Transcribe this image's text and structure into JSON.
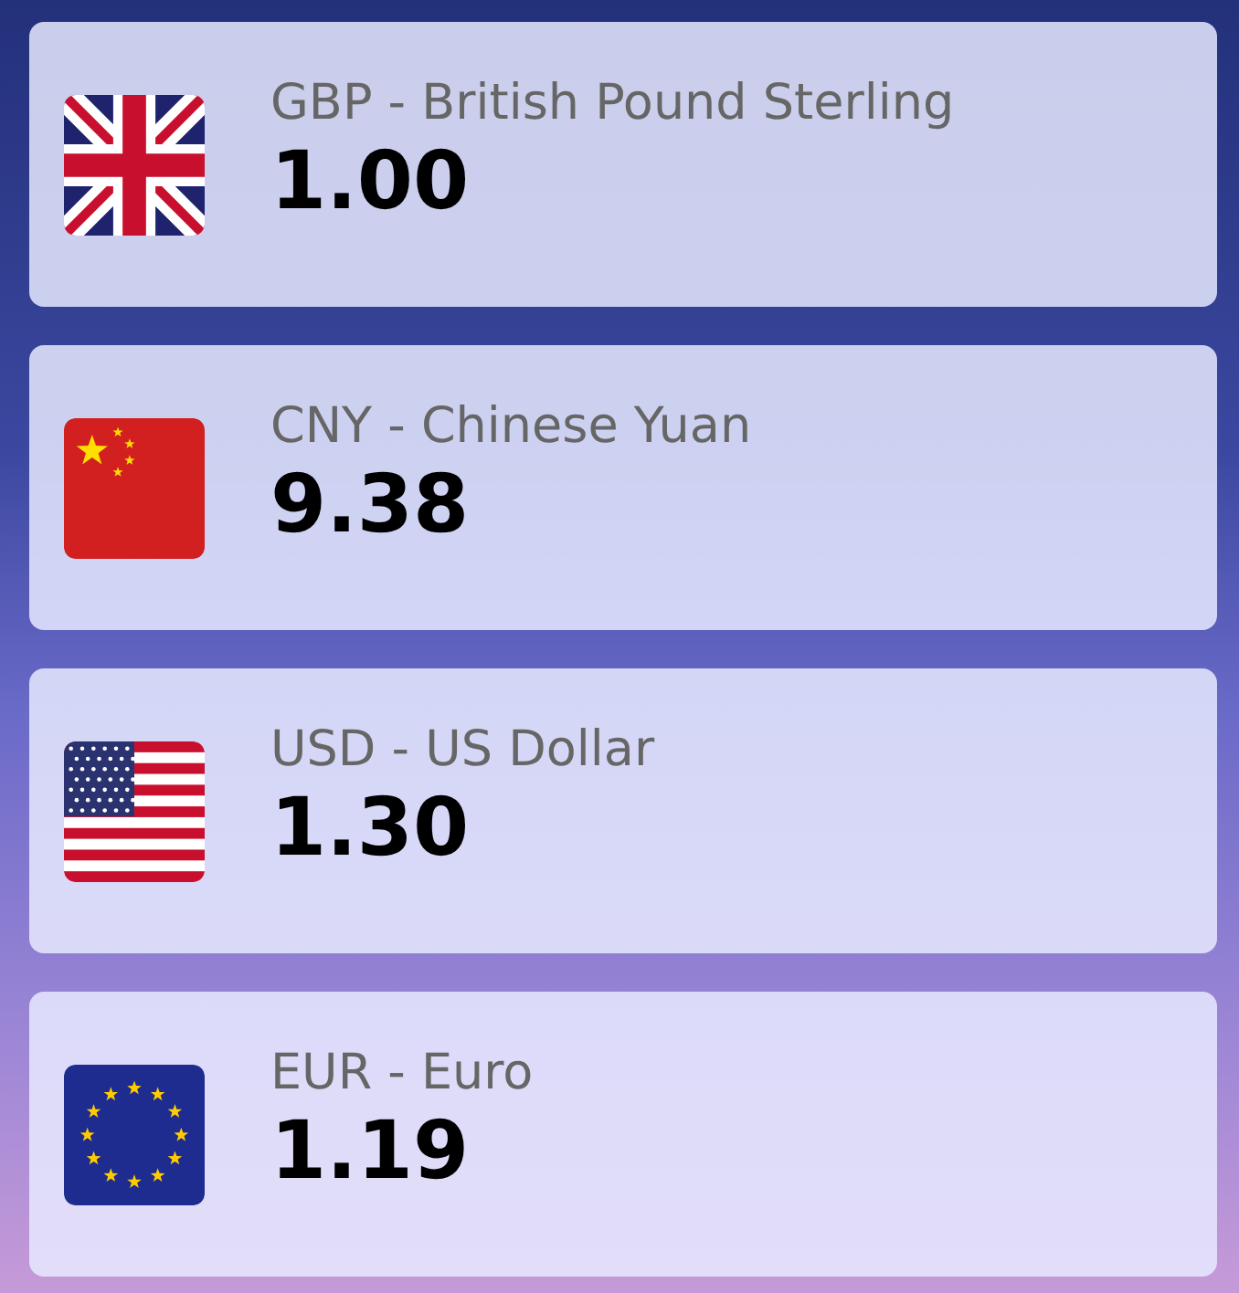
{
  "currencies": [
    {
      "kind": "gb",
      "name": "GBP - British Pound Sterling",
      "rate": "1.00"
    },
    {
      "kind": "cn",
      "name": "CNY - Chinese Yuan",
      "rate": "9.38"
    },
    {
      "kind": "us",
      "name": "USD - US Dollar",
      "rate": "1.30"
    },
    {
      "kind": "eu",
      "name": "EUR - Euro",
      "rate": "1.19"
    }
  ]
}
